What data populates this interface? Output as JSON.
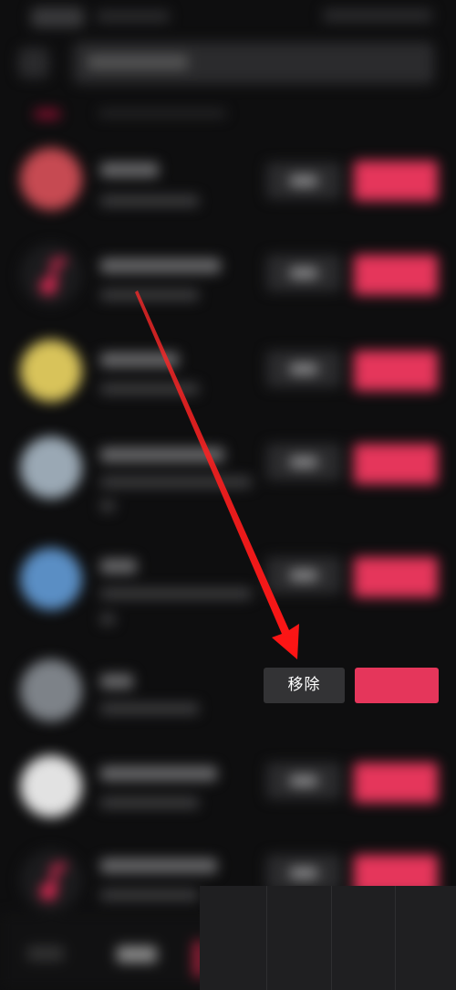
{
  "screen": {
    "accent_color": "#e5365b",
    "background_color": "#0e0e0f"
  },
  "rows": [
    {
      "avatar_color": "#c64a52",
      "icon": "avatar"
    },
    {
      "avatar_color": "#1b1b1d",
      "icon": "music-note-icon"
    },
    {
      "avatar_color": "#d8c35a",
      "icon": "avatar"
    },
    {
      "avatar_color": "#9aa8b4",
      "icon": "avatar"
    },
    {
      "avatar_color": "#5a8ec4",
      "icon": "avatar"
    },
    {
      "avatar_color": "#7d8288",
      "icon": "avatar"
    },
    {
      "avatar_color": "#e2e2e2",
      "icon": "avatar"
    },
    {
      "avatar_color": "#1b1b1d",
      "icon": "music-note-icon"
    }
  ],
  "highlighted_row": {
    "remove_label": "移除"
  },
  "annotation": {
    "arrow_color": "#ff1a1a"
  }
}
